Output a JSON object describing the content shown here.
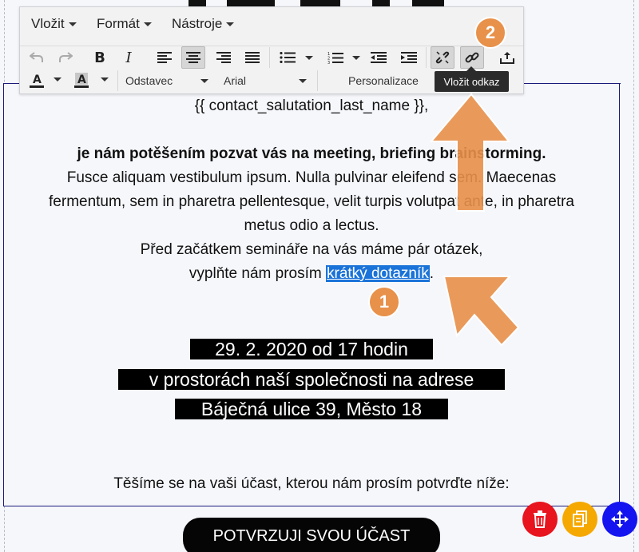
{
  "menubar": {
    "insert": "Vložit",
    "format": "Formát",
    "tools": "Nástroje"
  },
  "toolbar": {
    "paragraph_select": "Odstavec",
    "font_select": "Arial",
    "personalize_select": "Personalizace",
    "tooltip": "Vložit odkaz"
  },
  "content": {
    "salutation": "{{ contact_salutation_last_name }},",
    "invite_bold": "je nám potěšením pozvat vás na meeting, briefing brainstorming.",
    "lorem_1": "Fusce aliquam vestibulum ipsum. Nulla pulvinar eleifend sem. Maecenas",
    "lorem_2": "fermentum, sem in pharetra pellentesque, velit turpis volutpat ante, in pharetra",
    "lorem_3": "metus odio a lectus.",
    "before_seminar": "Před začátkem semináře na vás máme pár otázek,",
    "fill_prefix": "vyplňte nám prosím ",
    "link_text": "krátký dotazník",
    "fill_suffix": ".",
    "date_line": "29. 2. 2020 od 17 hodin",
    "location_line": "v prostorách naší společnosti na adrese",
    "address_line": "Báječná ulice 39, Město 18",
    "closing": "Těšíme se na vaši účast, kterou nám prosím potvrďte níže:",
    "confirm_button": "POTVRZUJI SVOU ÚČAST"
  },
  "annotations": {
    "step_1": "1",
    "step_2": "2",
    "color": "#e8914a"
  },
  "colors": {
    "selection": "#1a73d9",
    "delete_fab": "#e8141e",
    "copy_fab": "#f5a800",
    "move_fab": "#1414f0"
  }
}
